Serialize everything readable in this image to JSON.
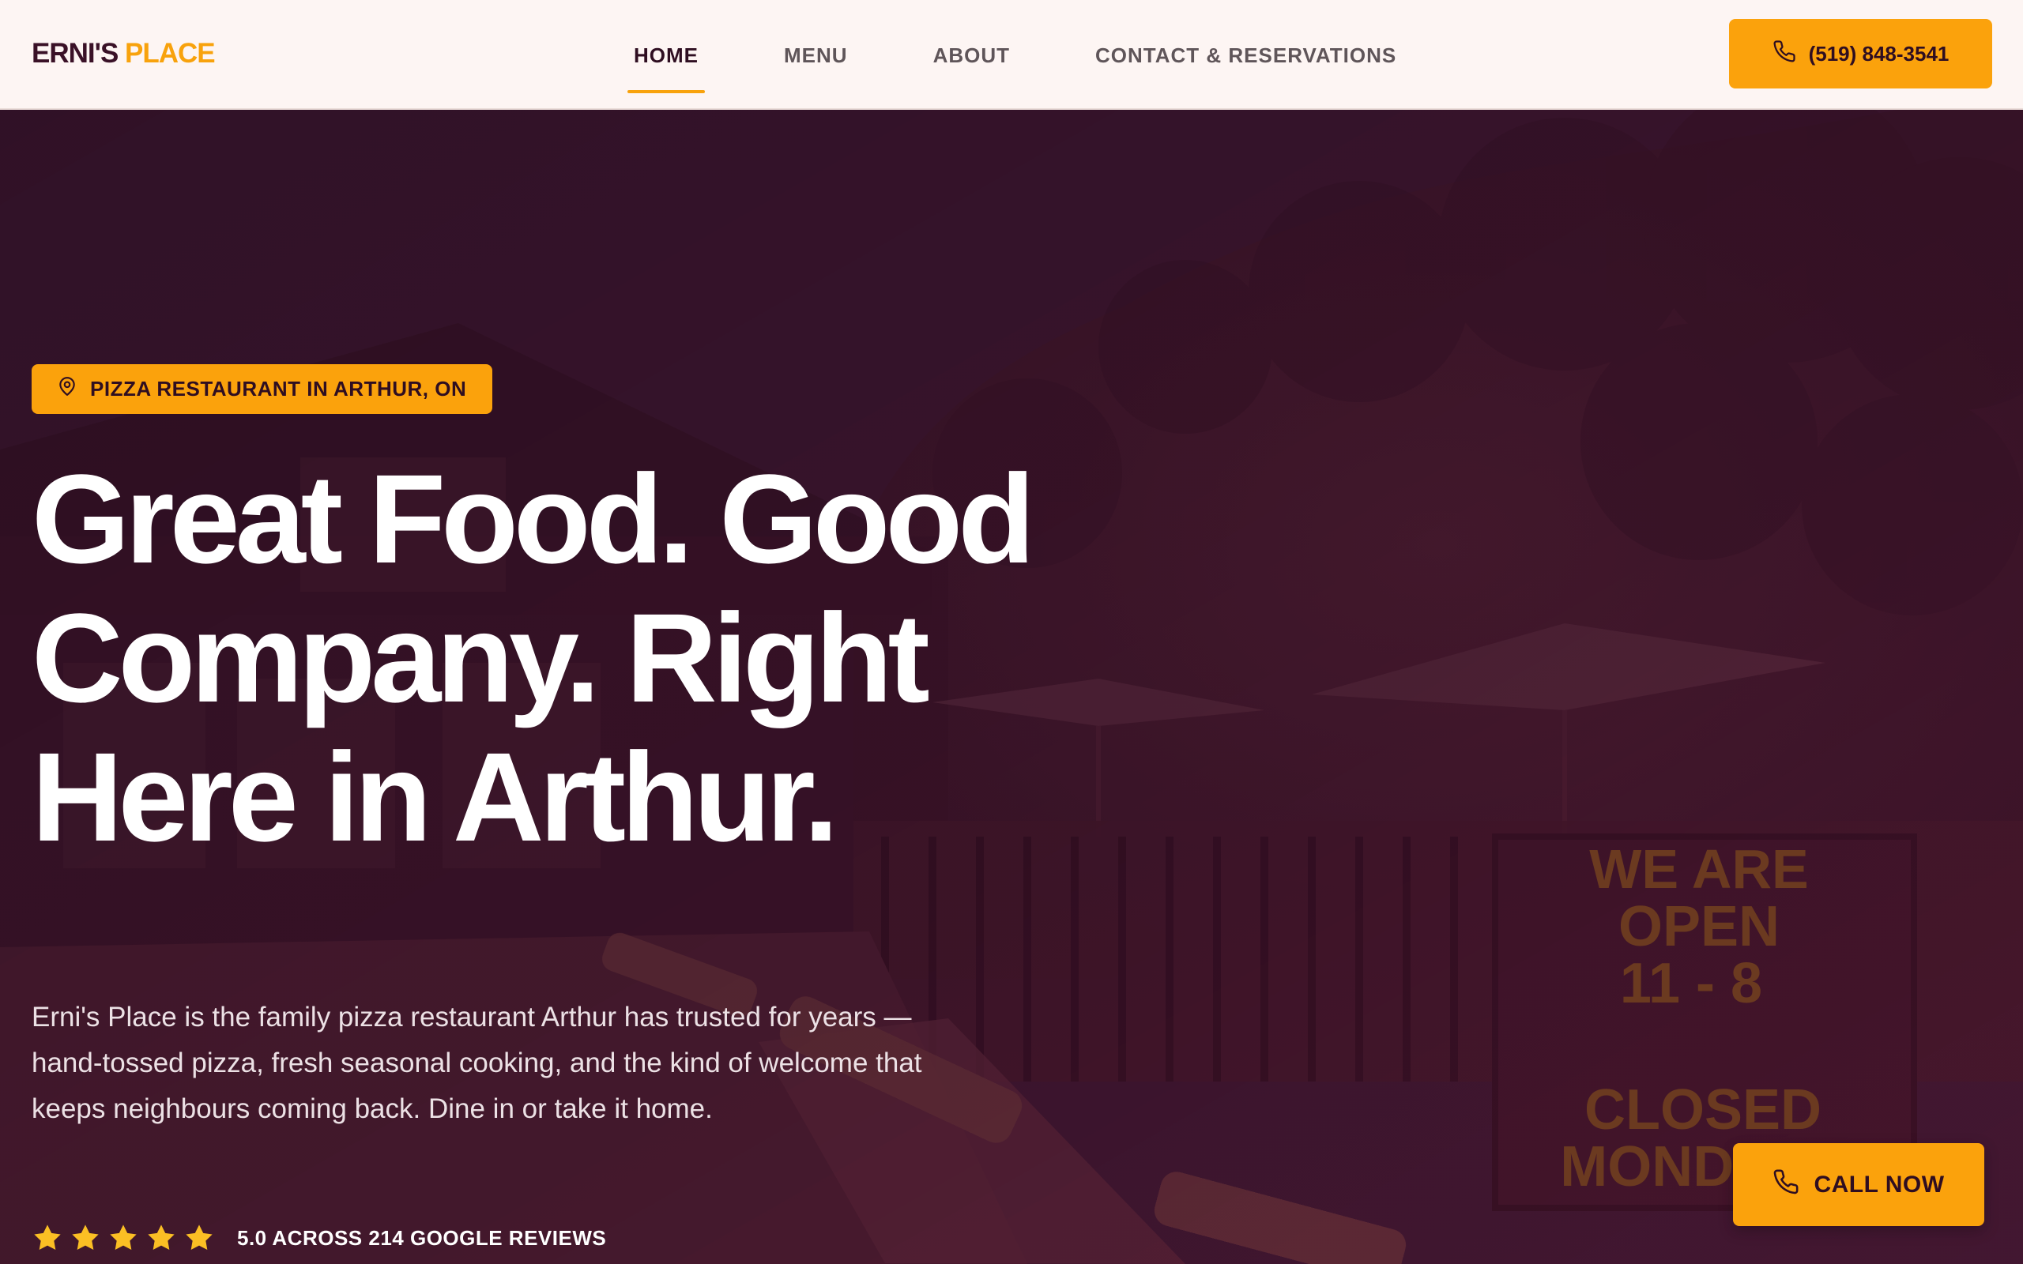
{
  "brand": {
    "name_part1": "ERNI'S",
    "name_part2": "PLACE"
  },
  "nav": {
    "items": [
      {
        "label": "HOME",
        "active": true
      },
      {
        "label": "MENU",
        "active": false
      },
      {
        "label": "ABOUT",
        "active": false
      },
      {
        "label": "CONTACT & RESERVATIONS",
        "active": false
      }
    ]
  },
  "header": {
    "phone_label": "(519) 848-3541",
    "phone_icon": "phone-icon"
  },
  "hero": {
    "badge_icon": "map-pin-icon",
    "badge": "PIZZA RESTAURANT IN ARTHUR, ON",
    "headline_line1": "Great Food. Good",
    "headline_line2": "Company. Right",
    "headline_line3": "Here in Arthur.",
    "intro": "Erni's Place is the family pizza restaurant Arthur has trusted for years — hand-tossed pizza, fresh seasonal cooking, and the kind of welcome that keeps neighbours coming back. Dine in or take it home.",
    "rating_stars": 5,
    "rating_text": "5.0 ACROSS 214 GOOGLE REVIEWS",
    "sign_line1": "WE   ARE",
    "sign_line2": "OPEN",
    "sign_line3": "11 - 8",
    "sign_line4": "CLOSED",
    "sign_line5": "MONDAYS"
  },
  "cta": {
    "call_now_label": "CALL NOW",
    "call_now_icon": "phone-icon"
  },
  "colors": {
    "accent": "#fba20c",
    "brand_dark": "#3a1127",
    "header_bg": "#fdf5f3",
    "hero_overlay": "#3a1429"
  }
}
